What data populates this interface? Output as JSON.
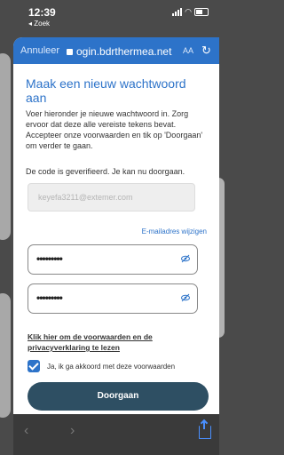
{
  "status_bar": {
    "time": "12:39",
    "back_app": "◂ Zoek"
  },
  "browser": {
    "cancel_label": "Annuleer",
    "url": "ogin.bdrthermea.net",
    "reader_label": "AA",
    "reload_icon": "reload-icon"
  },
  "page": {
    "title": "Maak een nieuw wachtwoord aan",
    "intro": "Voer hieronder je nieuwe wachtwoord in. Zorg ervoor dat deze alle vereiste tekens bevat. Accepteer onze voorwaarden en tik op 'Doorgaan' om verder te gaan.",
    "verified_text": "De code is geverifieerd. Je kan nu doorgaan.",
    "email_value": "keyefa3211@extemer.com",
    "change_email_label": "E-mailadres wijzigen",
    "password_mask": "•••••••••",
    "confirm_password_mask": "•••••••••",
    "terms_link": "Klik hier om de voorwaarden en de privacyverklaring te lezen",
    "agree_label": "Ja, ik ga akkoord met deze voorwaarden",
    "agree_checked": true,
    "continue_label": "Doorgaan"
  },
  "colors": {
    "accent": "#2d73c9",
    "button": "#2e4f63"
  }
}
